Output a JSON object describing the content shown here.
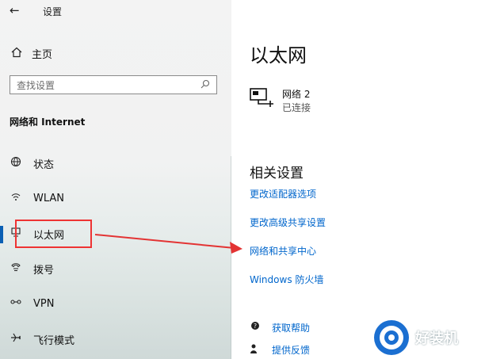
{
  "topbar": {
    "back_glyph": "←",
    "title": "设置"
  },
  "sidebar": {
    "home_label": "主页",
    "search_placeholder": "查找设置",
    "section_title": "网络和 Internet",
    "items": [
      {
        "label": "状态",
        "icon": "globe-icon"
      },
      {
        "label": "WLAN",
        "icon": "wifi-icon"
      },
      {
        "label": "以太网",
        "icon": "ethernet-icon",
        "selected": true
      },
      {
        "label": "拨号",
        "icon": "phone-icon"
      },
      {
        "label": "VPN",
        "icon": "vpn-icon"
      },
      {
        "label": "飞行模式",
        "icon": "airplane-icon"
      }
    ]
  },
  "main": {
    "title": "以太网",
    "network": {
      "name": "网络 2",
      "status": "已连接"
    },
    "related_title": "相关设置",
    "links": [
      "更改适配器选项",
      "更改高级共享设置",
      "网络和共享中心",
      "Windows 防火墙"
    ],
    "help": [
      {
        "label": "获取帮助",
        "icon": "help-chat-icon"
      },
      {
        "label": "提供反馈",
        "icon": "feedback-icon"
      }
    ]
  },
  "watermark": {
    "text": "好装机"
  },
  "colors": {
    "accent": "#0a5fb4",
    "link": "#0066cc",
    "highlight": "#e33333"
  }
}
